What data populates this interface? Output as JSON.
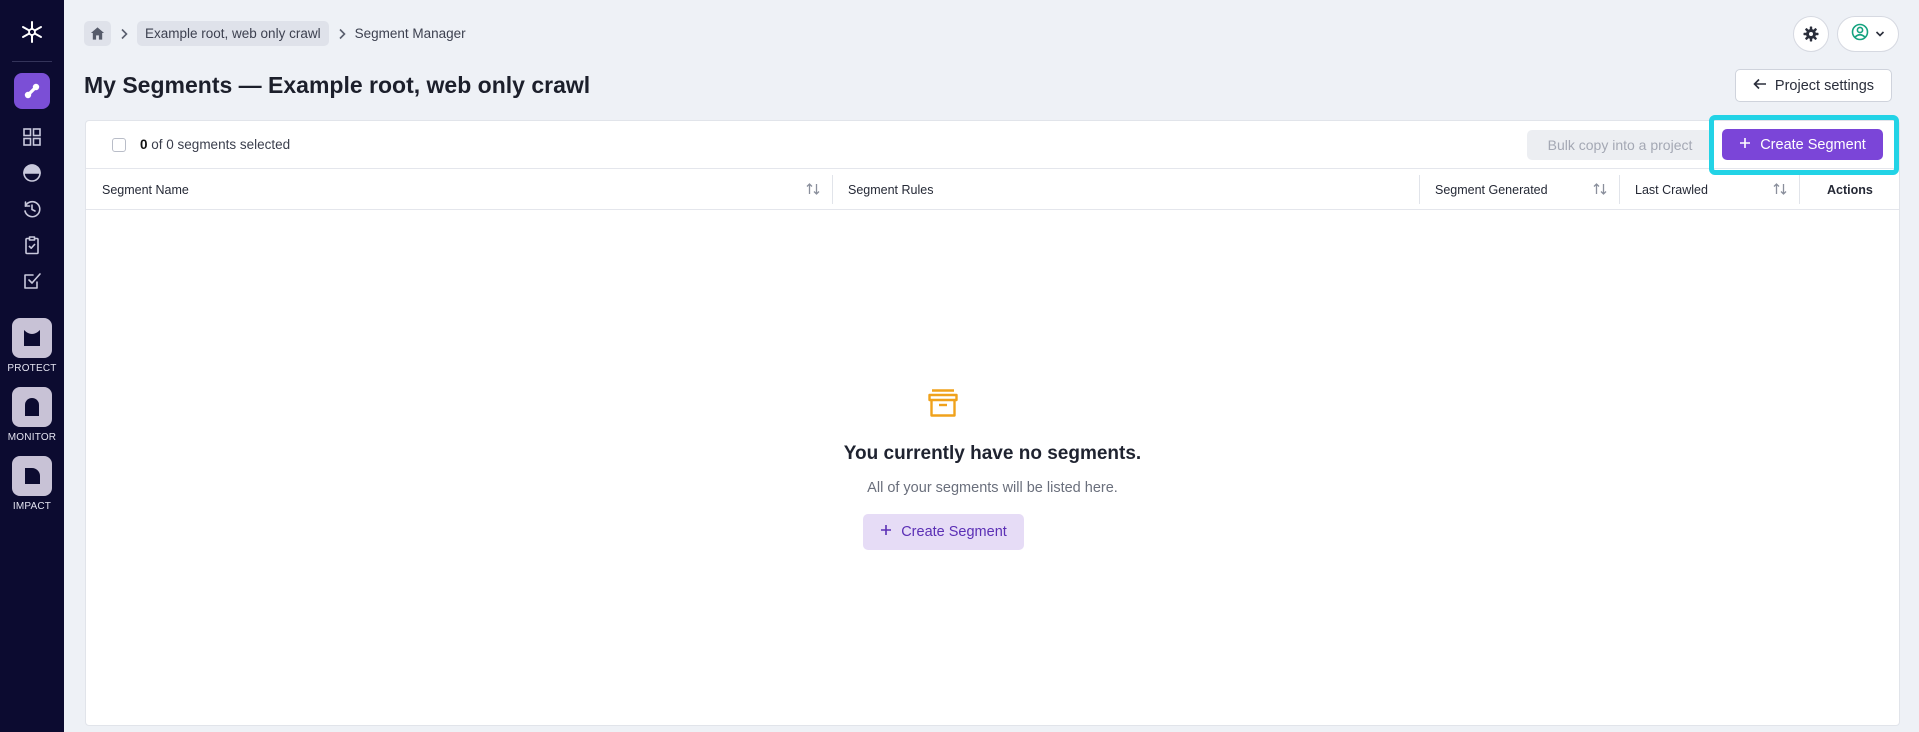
{
  "sidebar": {
    "logo_icon": "asterisk-logo-icon",
    "nav_icons": [
      "link-icon",
      "grid-icon",
      "gauge-icon",
      "history-icon",
      "clipboard-icon",
      "checkbox-icon"
    ],
    "apps": [
      {
        "label": "PROTECT",
        "icon": "protect-icon"
      },
      {
        "label": "MONITOR",
        "icon": "monitor-icon"
      },
      {
        "label": "IMPACT",
        "icon": "impact-icon"
      }
    ]
  },
  "breadcrumb": {
    "home_icon": "home-icon",
    "project": "Example root, web only crawl",
    "current": "Segment Manager"
  },
  "header": {
    "title": "My Segments — Example root, web only crawl",
    "project_settings_label": "Project settings"
  },
  "toolbar": {
    "selected_count": "0",
    "selected_suffix": "of 0 segments selected",
    "bulk_copy_label": "Bulk copy into a project",
    "create_label": "Create Segment"
  },
  "table": {
    "columns": [
      "Segment Name",
      "Segment Rules",
      "Segment Generated",
      "Last Crawled",
      "Actions"
    ]
  },
  "empty_state": {
    "icon": "archive-box-icon",
    "title": "You currently have no segments.",
    "subtitle": "All of your segments will be listed here.",
    "button_label": "Create Segment"
  },
  "colors": {
    "sidebar_bg": "#0c0b30",
    "accent": "#7b45d8",
    "highlight": "#22d3e6",
    "empty_icon": "#f0a21c"
  }
}
